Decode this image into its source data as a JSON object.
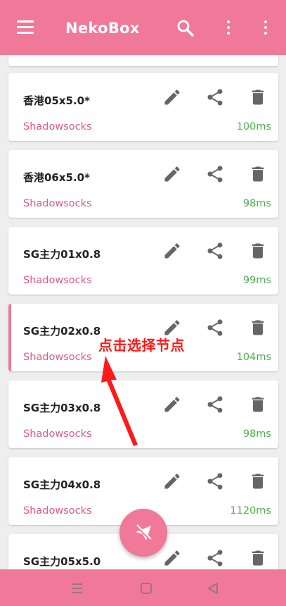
{
  "app": {
    "title": "NekoBox"
  },
  "annotation": "点击选择节点",
  "profiles": [
    {
      "name": "香港05x5.0*",
      "protocol": "Shadowsocks",
      "latency": "100ms"
    },
    {
      "name": "香港06x5.0*",
      "protocol": "Shadowsocks",
      "latency": "98ms"
    },
    {
      "name": "SG主力01x0.8",
      "protocol": "Shadowsocks",
      "latency": "99ms"
    },
    {
      "name": "SG主力02x0.8",
      "protocol": "Shadowsocks",
      "latency": "104ms",
      "selected": true
    },
    {
      "name": "SG主力03x0.8",
      "protocol": "Shadowsocks",
      "latency": "98ms"
    },
    {
      "name": "SG主力04x0.8",
      "protocol": "Shadowsocks",
      "latency": "1120ms"
    },
    {
      "name": "SG主力05x5.0",
      "protocol": "",
      "latency": ""
    }
  ],
  "colors": {
    "accent": "#f07898",
    "protocol": "#e0588a",
    "latency": "#4caf50",
    "annotation": "#ff1a1a"
  },
  "icons": {
    "appbar": [
      "menu-icon",
      "search-icon",
      "more-vert-icon",
      "more-vert-icon"
    ],
    "card_actions": [
      "edit-icon",
      "share-icon",
      "delete-icon"
    ],
    "fab": "paper-plane-off-icon",
    "navbar": [
      "recent-apps-icon",
      "home-icon",
      "back-icon"
    ]
  }
}
